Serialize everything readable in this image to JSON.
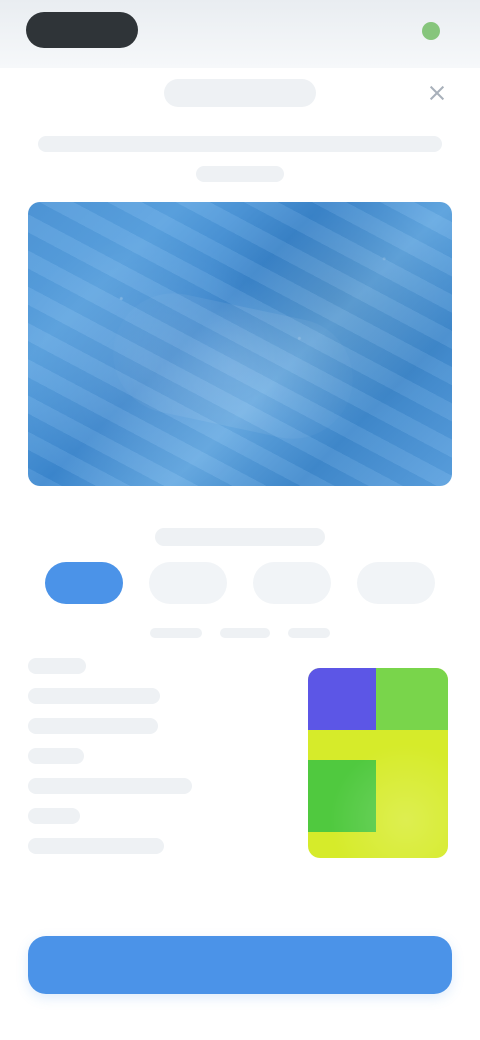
{
  "status_bar": {},
  "top_bar": {},
  "media": {},
  "tabs": {
    "selected_index": 0,
    "count": 4
  },
  "details": {},
  "colors": {
    "accent": "#4b93e8",
    "image": "#5aa0df",
    "swatch_purple": "#5c56e6",
    "swatch_green": "#79d54b",
    "swatch_lime": "#d6eb2a",
    "swatch_green_dark": "#50c93f"
  },
  "icons": {
    "close": "close-icon"
  },
  "actions": {}
}
